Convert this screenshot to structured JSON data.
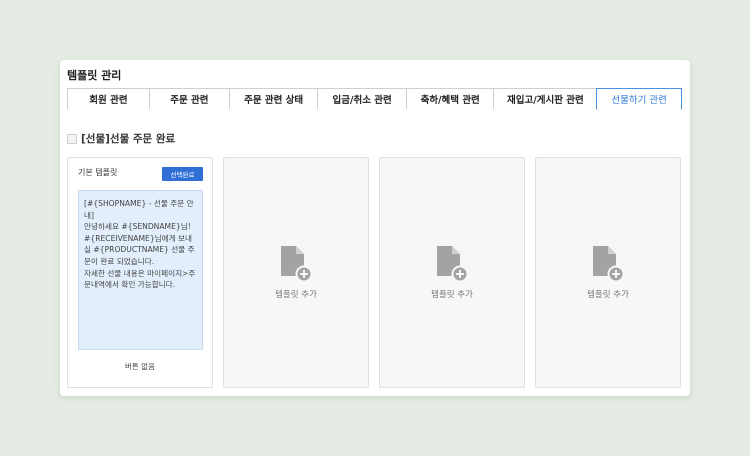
{
  "panel": {
    "title": "템플릿 관리"
  },
  "tabs": [
    {
      "label": "회원 관련",
      "active": false
    },
    {
      "label": "주문 관련",
      "active": false
    },
    {
      "label": "주문 관련 상태",
      "active": false
    },
    {
      "label": "입금/취소 관련",
      "active": false
    },
    {
      "label": "축하/혜택 관련",
      "active": false
    },
    {
      "label": "재입고/게시판 관련",
      "active": false
    },
    {
      "label": "선물하기 관련",
      "active": true
    }
  ],
  "section": {
    "title": "[선물]선물 주문 완료",
    "checked": false
  },
  "template_card": {
    "header": "기본 템플릿",
    "select_button": "선택완료",
    "message": "[#{SHOPNAME} - 선물 주문 안내]\n안녕하세요 #{SENDNAME}님!\n#{RECEIVENAME}님에게 보내실 #{PRODUCTNAME} 선물 주문이 완료 되었습니다.\n자세한 선물 내용은 마이페이지>주문내역에서 확인 가능합니다.",
    "footer": "버튼 없음"
  },
  "add_cards": [
    {
      "label": "템플릿 추가",
      "icon": "document-add-icon"
    },
    {
      "label": "템플릿 추가",
      "icon": "document-add-icon"
    },
    {
      "label": "템플릿 추가",
      "icon": "document-add-icon"
    }
  ],
  "colors": {
    "accent": "#2f6fd6",
    "active_tab": "#2f7bd8",
    "message_bg": "#e2eefc",
    "page_bg": "#e4ece4"
  }
}
